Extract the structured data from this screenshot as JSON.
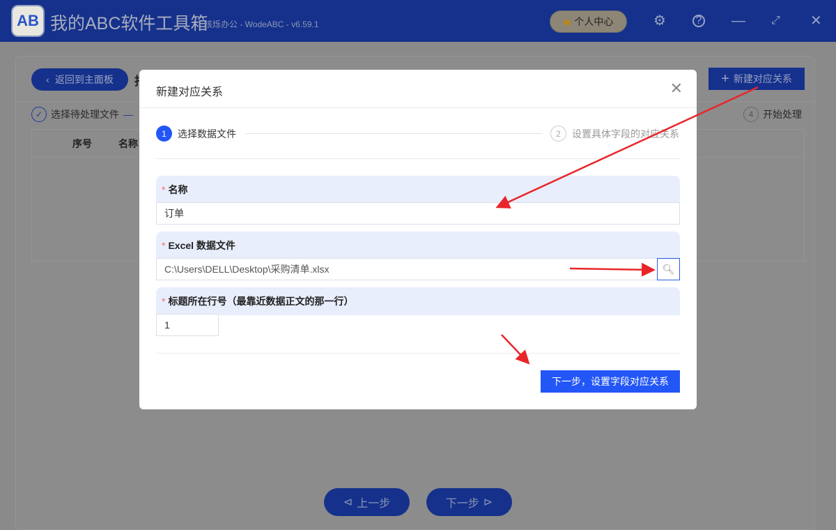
{
  "app": {
    "title": "我的ABC软件工具箱",
    "subtitle": "核烁办公 - WodeABC - v6.59.1",
    "logo_text": "AB",
    "personal_center": "个人中心"
  },
  "toolbar": {
    "back": "返回到主面板",
    "partial_title": "指",
    "new_relation": "新建对应关系"
  },
  "steps": {
    "step1": "选择待处理文件",
    "step4_num": "4",
    "step4": "开始处理"
  },
  "table": {
    "headers": [
      "序号",
      "名称"
    ]
  },
  "nav": {
    "prev": "上一步",
    "next": "下一步"
  },
  "dialog": {
    "title": "新建对应关系",
    "steps": [
      {
        "num": "1",
        "label": "选择数据文件"
      },
      {
        "num": "2",
        "label": "设置具体字段的对应关系"
      }
    ],
    "fields": {
      "name": {
        "label": "名称",
        "value": "订单"
      },
      "file": {
        "label": "Excel 数据文件",
        "value": "C:\\Users\\DELL\\Desktop\\采购清单.xlsx"
      },
      "header_row": {
        "label": "标题所在行号（最靠近数据正文的那一行）",
        "value": "1"
      }
    },
    "submit": "下一步，设置字段对应关系"
  },
  "colors": {
    "brand": "#2356f6",
    "annotation": "#e8262a"
  }
}
